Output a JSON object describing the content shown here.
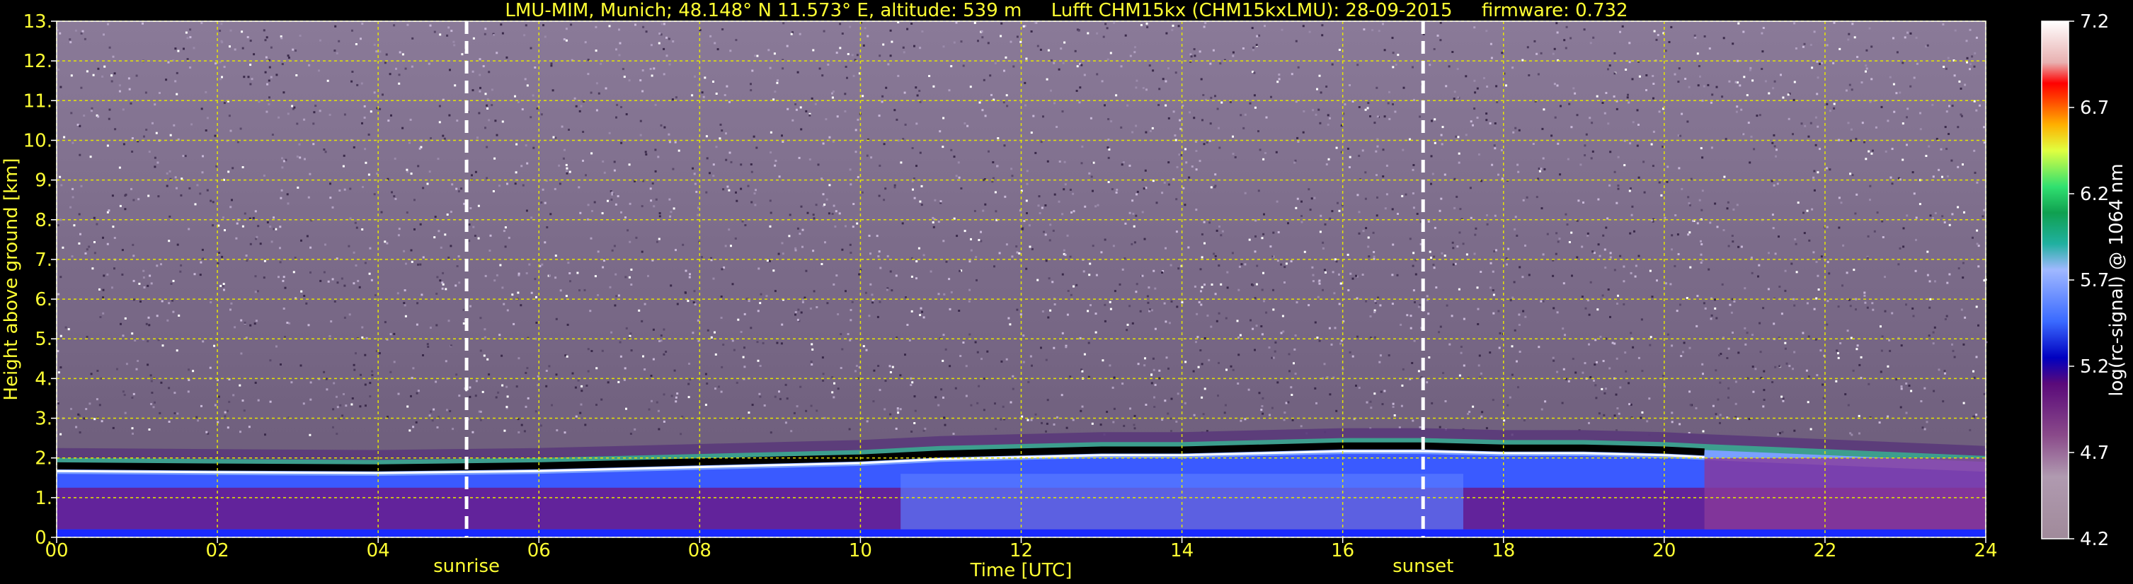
{
  "header": {
    "site": "LMU-MIM, Munich; 48.148° N 11.573° E, altitude: 539 m",
    "instrument": "Lufft CHM15kx (CHM15kxLMU): 28-09-2015",
    "firmware": "firmware: 0.732"
  },
  "colors": {
    "background": "#000000",
    "text": "#ffff33",
    "grid": "#e6e600",
    "marker_line": "#ffffff"
  },
  "chart_data": {
    "type": "heatmap",
    "xlabel": "Time [UTC]",
    "ylabel": "Height above ground [km]",
    "colorbar_label": "log(rc-signal) @ 1064 nm",
    "xlim": [
      0,
      24
    ],
    "ylim": [
      0,
      13
    ],
    "clim": [
      4.2,
      7.2
    ],
    "x_ticks": [
      "00",
      "02",
      "04",
      "06",
      "08",
      "10",
      "12",
      "14",
      "16",
      "18",
      "20",
      "22",
      "24"
    ],
    "y_ticks": [
      "0.",
      "1.",
      "2.",
      "3.",
      "4.",
      "5.",
      "6.",
      "7.",
      "8.",
      "9.",
      "10.",
      "11.",
      "12.",
      "13."
    ],
    "colorbar_ticks": [
      "4.2",
      "4.7",
      "5.2",
      "5.7",
      "6.2",
      "6.7",
      "7.2"
    ],
    "grid": true,
    "events": [
      {
        "label": "sunrise",
        "time": 5.1
      },
      {
        "label": "sunset",
        "time": 17.0
      }
    ],
    "boundary_layer_top_km": [
      {
        "t": 0,
        "h": 1.75
      },
      {
        "t": 2,
        "h": 1.72
      },
      {
        "t": 4,
        "h": 1.7
      },
      {
        "t": 6,
        "h": 1.75
      },
      {
        "t": 8,
        "h": 1.85
      },
      {
        "t": 10,
        "h": 1.95
      },
      {
        "t": 11,
        "h": 2.05
      },
      {
        "t": 12,
        "h": 2.1
      },
      {
        "t": 13,
        "h": 2.15
      },
      {
        "t": 14,
        "h": 2.15
      },
      {
        "t": 15,
        "h": 2.2
      },
      {
        "t": 16,
        "h": 2.25
      },
      {
        "t": 17,
        "h": 2.25
      },
      {
        "t": 18,
        "h": 2.2
      },
      {
        "t": 19,
        "h": 2.2
      },
      {
        "t": 20,
        "h": 2.15
      },
      {
        "t": 20.5,
        "h": 2.1
      }
    ]
  }
}
